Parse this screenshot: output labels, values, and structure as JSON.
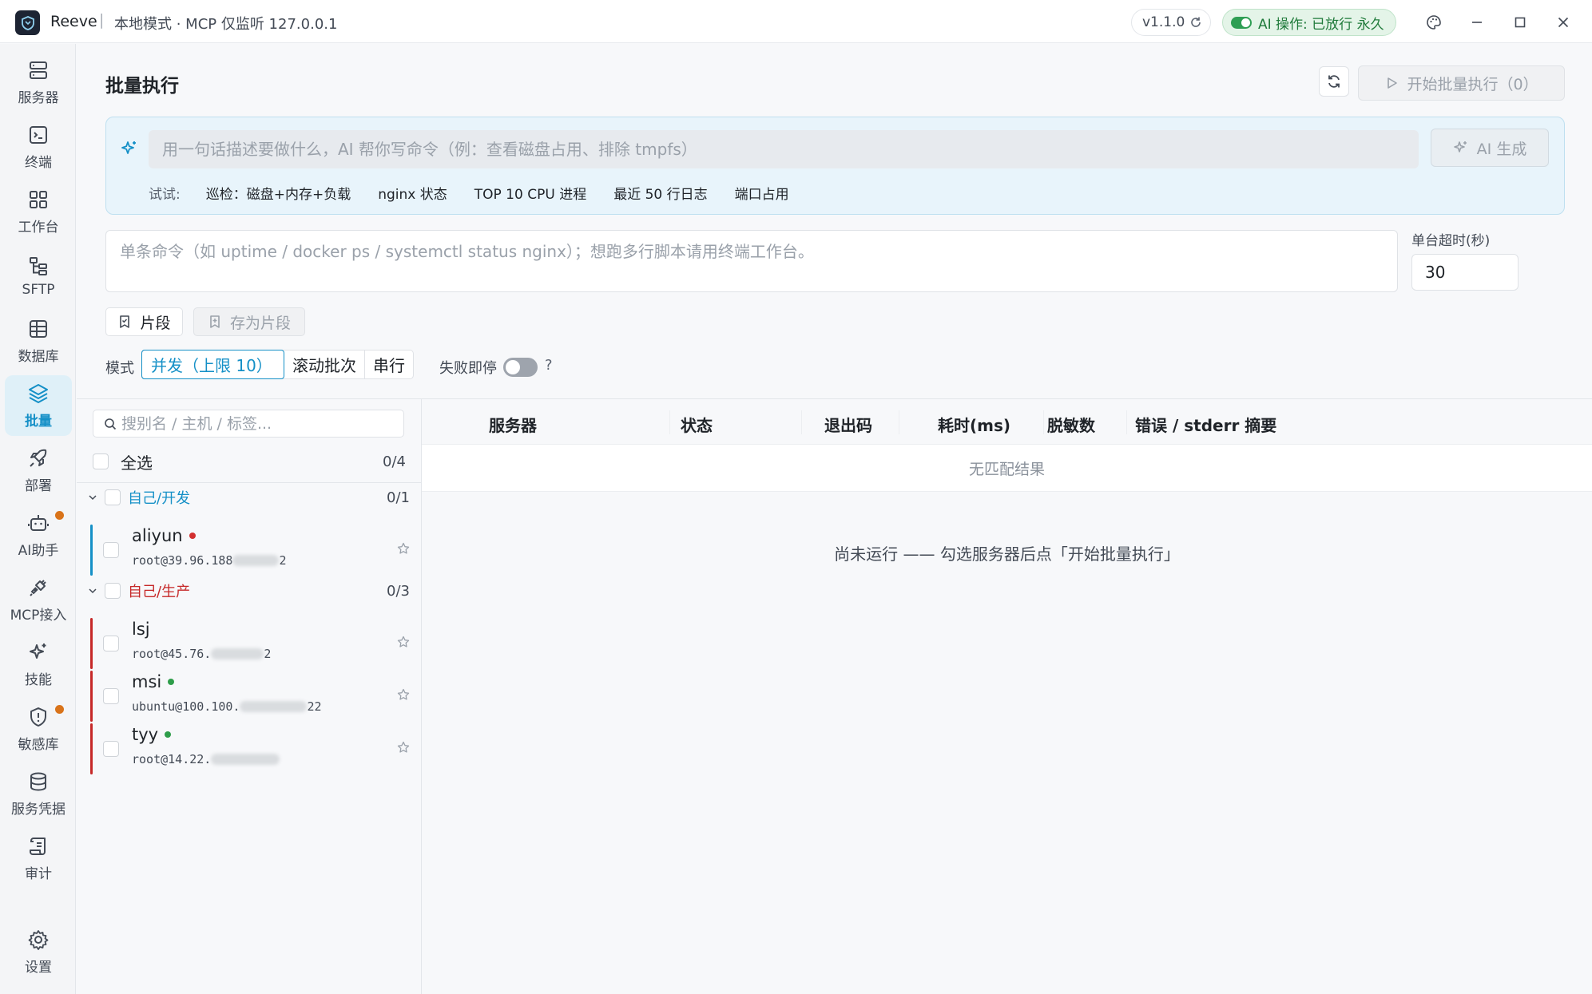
{
  "titlebar": {
    "app_name": "Reeve",
    "separator": "|",
    "status": "本地模式 · MCP 仅监听 127.0.0.1",
    "version": "v1.1.0",
    "ai_ops": "AI 操作: 已放行 永久"
  },
  "sidebar": {
    "items": [
      {
        "label": "服务器",
        "icon": "server-icon"
      },
      {
        "label": "终端",
        "icon": "terminal-icon"
      },
      {
        "label": "工作台",
        "icon": "grid-icon"
      },
      {
        "label": "SFTP",
        "icon": "folder-tree-icon"
      },
      {
        "label": "数据库",
        "icon": "table-icon"
      },
      {
        "label": "批量",
        "icon": "layers-icon",
        "active": true
      },
      {
        "label": "部署",
        "icon": "rocket-icon"
      },
      {
        "label": "AI助手",
        "icon": "bot-icon",
        "badge": true
      },
      {
        "label": "MCP接入",
        "icon": "plug-icon"
      },
      {
        "label": "技能",
        "icon": "sparkles-icon"
      },
      {
        "label": "敏感库",
        "icon": "shield-alert-icon",
        "badge": true
      },
      {
        "label": "服务凭据",
        "icon": "database-icon"
      },
      {
        "label": "审计",
        "icon": "scroll-icon"
      }
    ],
    "settings": {
      "label": "设置",
      "icon": "gear-icon"
    }
  },
  "main": {
    "title": "批量执行",
    "start_button": "开始批量执行（0）",
    "ai": {
      "placeholder": "用一句话描述要做什么，AI 帮你写命令（例：查看磁盘占用、排除 tmpfs）",
      "generate_button": "AI 生成",
      "try_label": "试试:",
      "chips": [
        "巡检：磁盘+内存+负载",
        "nginx 状态",
        "TOP 10 CPU 进程",
        "最近 50 行日志",
        "端口占用"
      ]
    },
    "command": {
      "placeholder": "单条命令（如 uptime / docker ps / systemctl status nginx）；想跑多行脚本请用终端工作台。",
      "timeout_label": "单台超时(秒)",
      "timeout_value": "30"
    },
    "snippet_button": "片段",
    "save_snippet_button": "存为片段",
    "mode": {
      "label": "模式",
      "options": [
        "并发（上限 10）",
        "滚动批次",
        "串行"
      ],
      "selected": "并发（上限 10）",
      "failstop_label": "失败即停",
      "failstop_on": false,
      "help": "?"
    }
  },
  "server_list": {
    "search_placeholder": "搜别名 / 主机 / 标签...",
    "select_all": "全选",
    "select_all_count": "0/4",
    "groups": [
      {
        "name": "自己/开发",
        "count": "0/1",
        "color": "#1590c7",
        "servers": [
          {
            "name": "aliyun",
            "addr": "root@39.96.188",
            "addr_tail": "2",
            "status_color": "#d22f2f"
          }
        ]
      },
      {
        "name": "自己/生产",
        "count": "0/3",
        "color": "#c62828",
        "servers": [
          {
            "name": "lsj",
            "addr": "root@45.76.",
            "addr_tail": "2",
            "status_color": ""
          },
          {
            "name": "msi",
            "addr": "ubuntu@100.100.",
            "addr_tail": "22",
            "status_color": "#2e9d4a"
          },
          {
            "name": "tyy",
            "addr": "root@14.22.",
            "addr_tail": "",
            "status_color": "#2e9d4a"
          }
        ]
      }
    ]
  },
  "results": {
    "columns": [
      "服务器",
      "状态",
      "退出码",
      "耗时(ms)",
      "脱敏数",
      "错误 / stderr 摘要"
    ],
    "no_match": "无匹配结果",
    "not_run": "尚未运行 —— 勾选服务器后点「开始批量执行」"
  }
}
